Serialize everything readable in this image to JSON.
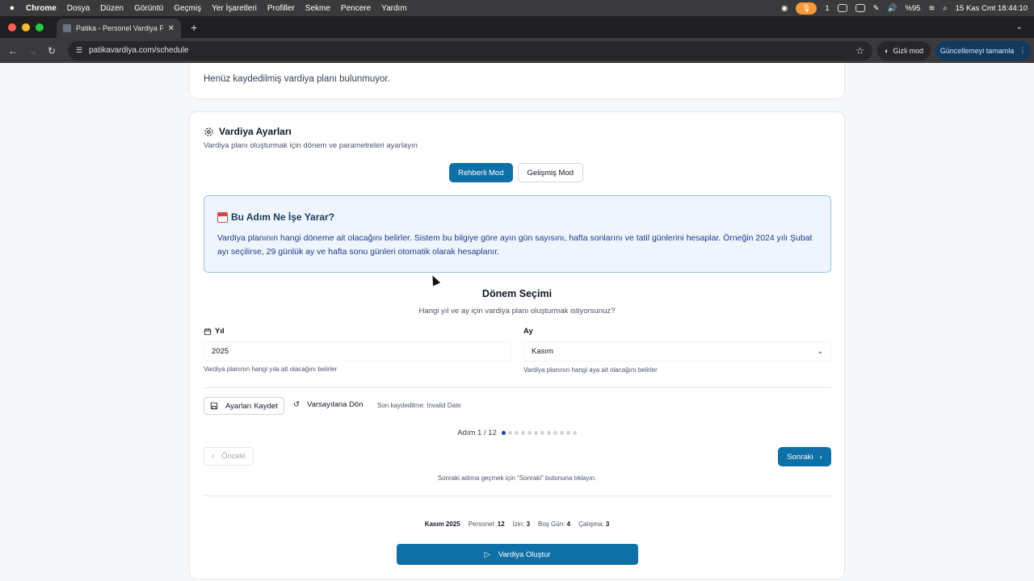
{
  "menubar": {
    "items": [
      "Chrome",
      "Dosya",
      "Düzen",
      "Görüntü",
      "Geçmiş",
      "Yer İşaretleri",
      "Profiller",
      "Sekme",
      "Pencere",
      "Yardım"
    ],
    "battery": "%95",
    "badge": "1",
    "datetime": "15 Kas Cmt  18:44:10"
  },
  "browser": {
    "tab_title": "Patika - Personel Vardiya Pla",
    "url": "patikavardiya.com/schedule",
    "incognito_label": "Gizli mod",
    "update_label": "Güncellemeyi tamamla"
  },
  "top_card": {
    "empty_text": "Henüz kaydedilmiş vardiya planı bulunmuyor."
  },
  "settings": {
    "title": "Vardiya Ayarları",
    "subtitle": "Vardiya planı oluşturmak için dönem ve parametreleri ayarlayın",
    "mode_guided": "Rehberli Mod",
    "mode_advanced": "Gelişmiş Mod",
    "info_title": "Bu Adım Ne İşe Yarar?",
    "info_body": "Vardiya planının hangi döneme ait olacağını belirler. Sistem bu bilgiye göre ayın gün sayısını, hafta sonlarını ve tatil günlerini hesaplar. Örneğin 2024 yılı Şubat ayı seçilirse, 29 günlük ay ve hafta sonu günleri otomatik olarak hesaplanır.",
    "section_title": "Dönem Seçimi",
    "section_sub": "Hangi yıl ve ay için vardiya planı oluşturmak istiyorsunuz?",
    "year_label": "Yıl",
    "year_value": "2025",
    "year_help": "Vardiya planının hangi yıla ait olacağını belirler",
    "month_label": "Ay",
    "month_value": "Kasım",
    "month_help": "Vardiya planının hangi aya ait olacağını belirler",
    "save_label": "Ayarları Kaydet",
    "reset_label": "Varsayılana Dön",
    "last_saved": "Son kaydedilme: Invalid Date",
    "step_text": "Adım 1 / 12",
    "prev_label": "Önceki",
    "next_label": "Sonraki",
    "hint": "Sonraki adıma geçmek için \"Sonraki\" butonuna tıklayın.",
    "summary": {
      "period": "Kasım 2025",
      "staff_label": "Personel:",
      "staff_value": "12",
      "leave_label": "İzin:",
      "leave_value": "3",
      "free_label": "Boş Gün:",
      "free_value": "4",
      "work_label": "Çalışma:",
      "work_value": "3"
    },
    "generate_label": "Vardiya Oluştur"
  }
}
